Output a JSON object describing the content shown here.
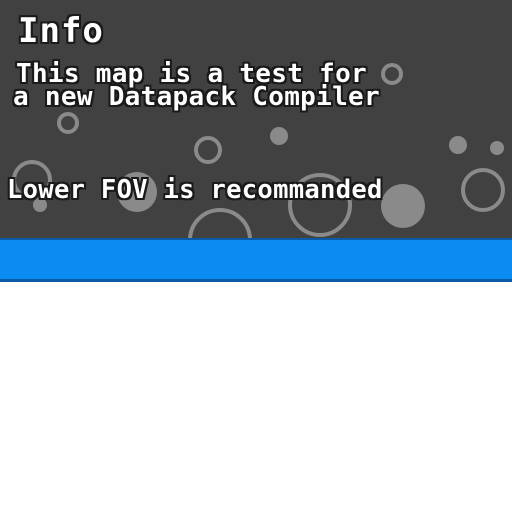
{
  "info_panel": {
    "title": "Info",
    "description_line_1": "This map is a test for",
    "description_line_2": "a new Datapack Compiler",
    "hint": "Lower FOV is recommanded"
  },
  "colors": {
    "panel_background": "#414141",
    "bubble": "#8a8a8a",
    "text": "#ffffff",
    "bar": "#0a8cf0",
    "bar_border": "#0a5aa8",
    "lower_area": "#ffffff"
  }
}
